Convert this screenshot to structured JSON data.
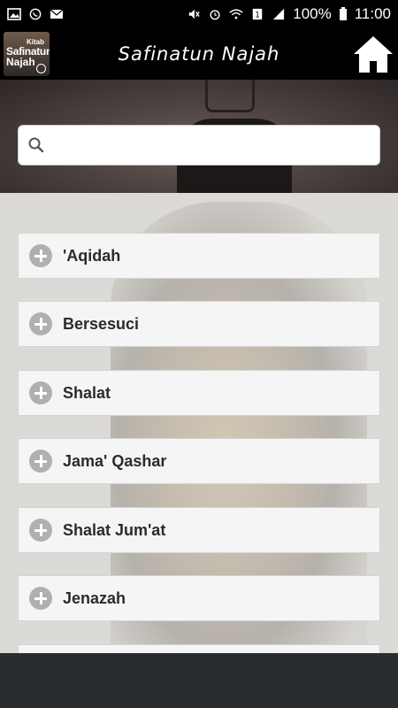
{
  "status_bar": {
    "battery": "100%",
    "time": "11:00",
    "notification_icons": [
      "image-icon",
      "whatsapp-icon",
      "mail-icon"
    ],
    "system_icons": [
      "mute-icon",
      "alarm-icon",
      "wifi-icon",
      "sim-icon",
      "signal-icon",
      "battery-icon"
    ]
  },
  "app_bar": {
    "logo": {
      "line1": "Kitab",
      "line2": "Safinatun",
      "line3": "Najah"
    },
    "title": "Safinatun Najah",
    "home_icon": "home-icon"
  },
  "search": {
    "value": "",
    "placeholder": "",
    "icon": "search-icon"
  },
  "menu": {
    "items": [
      {
        "label": "'Aqidah"
      },
      {
        "label": "Bersesuci"
      },
      {
        "label": "Shalat"
      },
      {
        "label": "Jama' Qashar"
      },
      {
        "label": "Shalat Jum'at"
      },
      {
        "label": "Jenazah"
      }
    ]
  },
  "colors": {
    "app_bar_bg": "#000000",
    "item_bg": "#f5f5f5",
    "plus_icon": "#b0b0b0",
    "bottom_bar": "#2a2d30"
  }
}
